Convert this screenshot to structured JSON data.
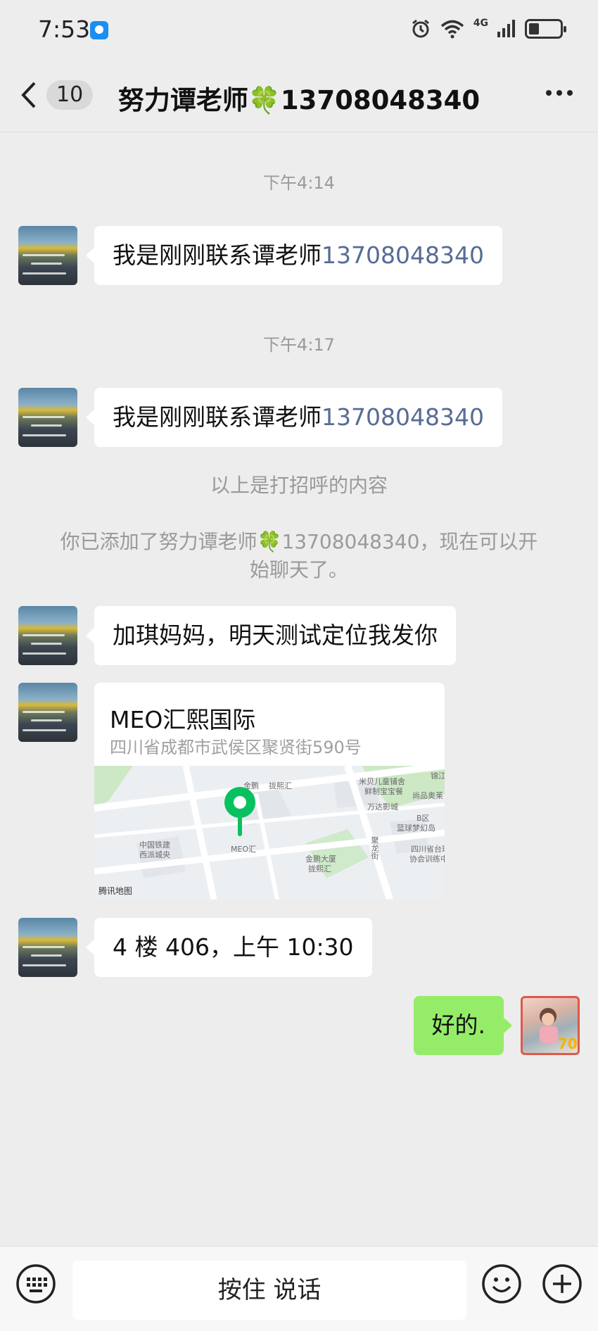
{
  "status_bar": {
    "time": "7:53",
    "network": "4G"
  },
  "nav": {
    "back_count": "10",
    "title": "努力谭老师🍀13708048340"
  },
  "messages": [
    {
      "time": "下午4:14",
      "text": "我是刚刚联系谭老师",
      "phone": "13708048340"
    },
    {
      "time": "下午4:17",
      "text": "我是刚刚联系谭老师",
      "phone": "13708048340"
    }
  ],
  "system": {
    "greeting_note": "以上是打招呼的内容",
    "added_note_line1": "你已添加了努力谭老师🍀13708048340，现在可以开",
    "added_note_line2": "始聊天了。"
  },
  "chat": {
    "msg3": "加琪妈妈，明天测试定位我发你",
    "location": {
      "name": "MEO汇熙国际",
      "address": "四川省成都市武侯区聚贤街590号",
      "credit": "腾讯地图",
      "labels": {
        "l1": "金鹏",
        "l2": "拢熙汇",
        "l3": "米贝儿童铺舍",
        "l4": "鲜制宝宝餐",
        "l5": "锦江",
        "l6": "尚品奥莱",
        "l7": "万达影城",
        "l8": "B区",
        "l9": "篮球梦幻岛",
        "l10": "中国铁建",
        "l11": "西派城央",
        "l12": "MEO汇",
        "l13": "金鹏大厦",
        "l14": "拢熙汇",
        "l15": "四川省台球",
        "l16": "协会训练中",
        "l17": "聚龙街"
      }
    },
    "msg5": "4 楼 406，上午 10:30",
    "msg6_mine": "好的."
  },
  "input_bar": {
    "voice_label": "按住 说话"
  },
  "colors": {
    "background": "#ededed",
    "bubble_mine": "#95ec69",
    "phone_link": "#576b95",
    "pin": "#07c160"
  }
}
